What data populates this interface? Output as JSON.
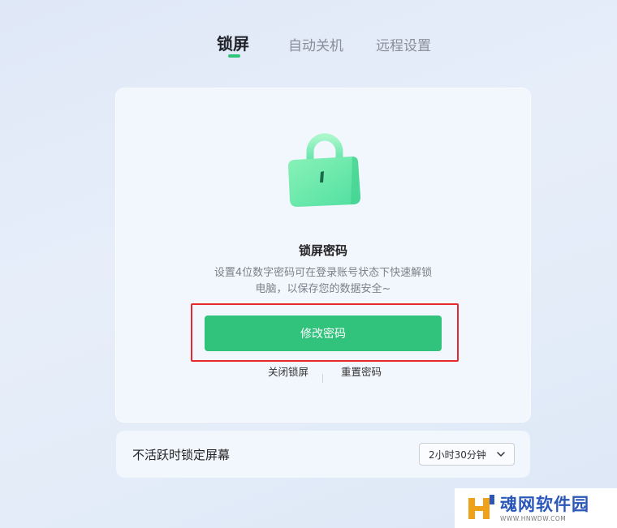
{
  "tabs": [
    {
      "label": "锁屏",
      "active": true
    },
    {
      "label": "自动关机",
      "active": false
    },
    {
      "label": "远程设置",
      "active": false
    }
  ],
  "lock_card": {
    "icon": "lock-icon",
    "title": "锁屏密码",
    "description": "设置4位数字密码可在登录账号状态下快速解锁电脑，以保存您的数据安全~",
    "primary_button": "修改密码",
    "link_close": "关闭锁屏",
    "link_reset": "重置密码"
  },
  "inactive_lock": {
    "label": "不活跃时锁定屏幕",
    "selected": "2小时30分钟"
  },
  "watermark": {
    "title": "魂网软件园",
    "subtitle": "WWW.HNWDW.COM"
  },
  "colors": {
    "accent": "#31c27c",
    "highlight": "#e8292c"
  }
}
